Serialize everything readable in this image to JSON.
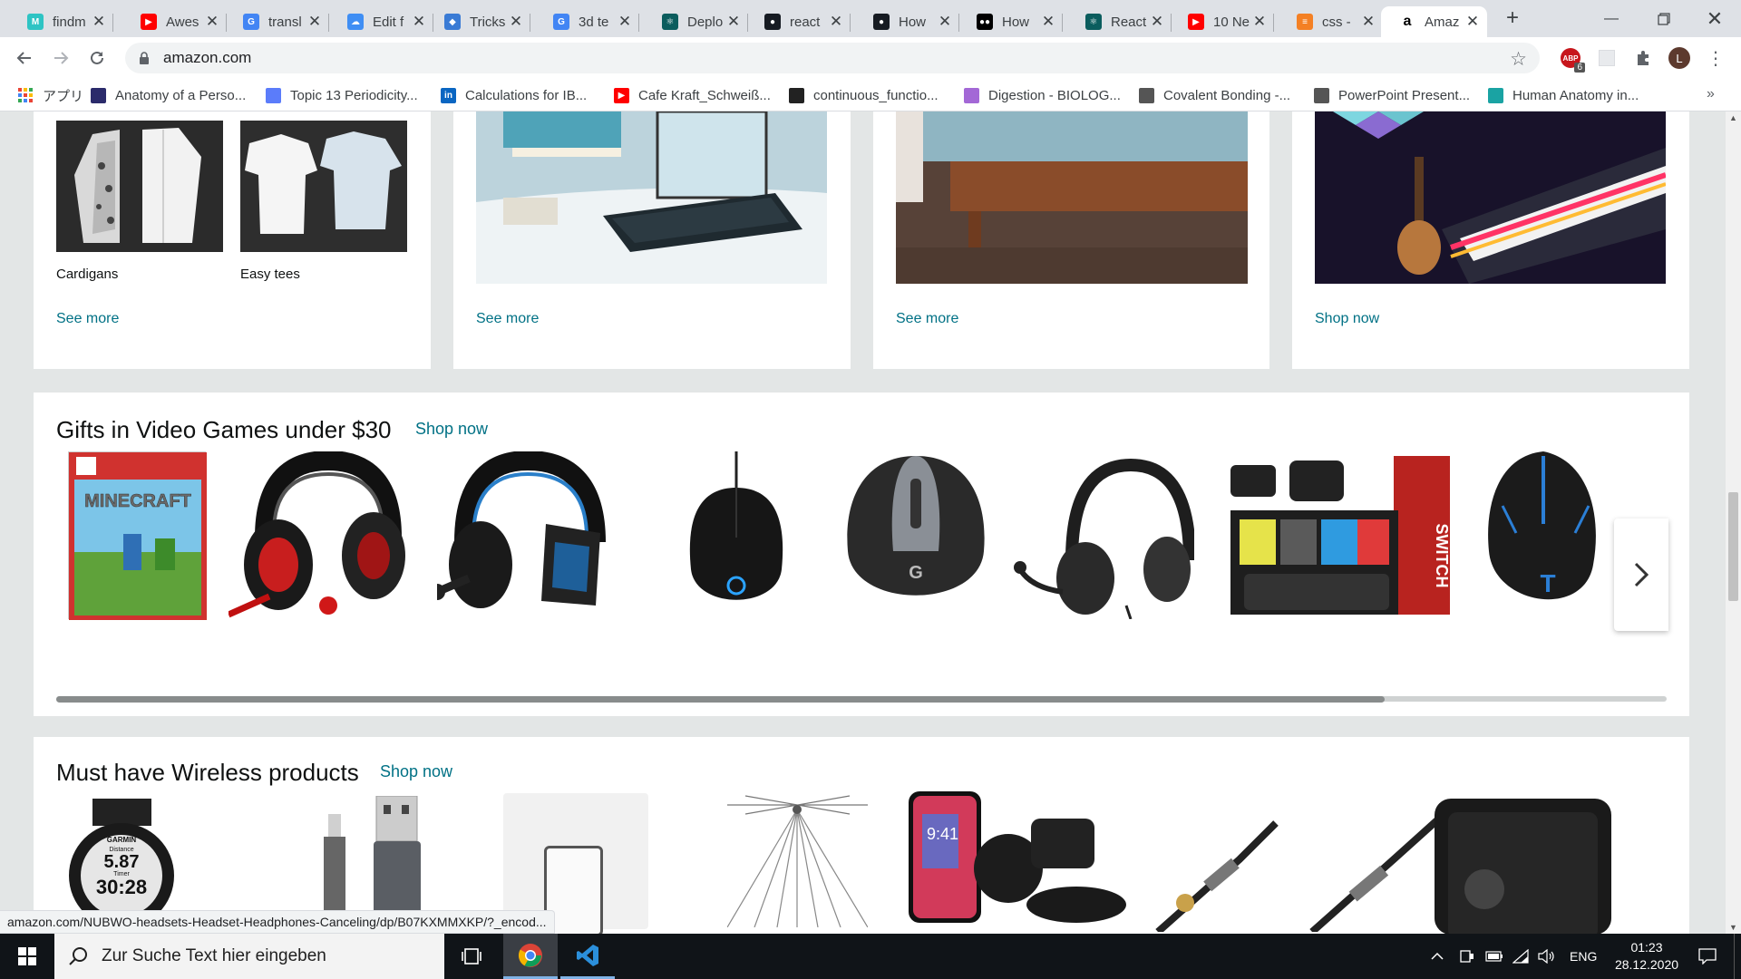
{
  "browser": {
    "tabs": [
      {
        "title": "findm",
        "favicon_color": "#2ec4c4",
        "favicon": "M"
      },
      {
        "title": "Awes",
        "favicon_color": "#ff0000",
        "favicon": "▶"
      },
      {
        "title": "transl",
        "favicon_color": "#4285f4",
        "favicon": "G"
      },
      {
        "title": "Edit f",
        "favicon_color": "#3f8ef4",
        "favicon": "☁"
      },
      {
        "title": "Tricks",
        "favicon_color": "#3a7bd5",
        "favicon": "◆"
      },
      {
        "title": "3d te",
        "favicon_color": "#4285f4",
        "favicon": "G"
      },
      {
        "title": "Deplo",
        "favicon_color": "#0b5d5e",
        "favicon": "⚛"
      },
      {
        "title": "react",
        "favicon_color": "#161b22",
        "favicon": "●"
      },
      {
        "title": "How",
        "favicon_color": "#161b22",
        "favicon": "●"
      },
      {
        "title": "How",
        "favicon_color": "#000000",
        "favicon": "●●"
      },
      {
        "title": "React",
        "favicon_color": "#0b5d5e",
        "favicon": "⚛"
      },
      {
        "title": "10 Ne",
        "favicon_color": "#ff0000",
        "favicon": "▶"
      },
      {
        "title": "css -",
        "favicon_color": "#f48024",
        "favicon": "≡"
      },
      {
        "title": "Amaz",
        "favicon_color": "#ffffff",
        "favicon": "a"
      }
    ],
    "url": "amazon.com",
    "profile_initial": "L",
    "abp_badge": "6",
    "bookmarks": [
      {
        "label": "アプリ",
        "icon": "apps-grid-icon",
        "color": "#ea4335"
      },
      {
        "label": "Anatomy of a Perso...",
        "icon": "bookmark-favicon-icon",
        "color": "#2b2b6b"
      },
      {
        "label": "Topic 13 Periodicity...",
        "icon": "bookmark-favicon-icon",
        "color": "#5b7cfa"
      },
      {
        "label": "Calculations for IB...",
        "icon": "linkedin-icon",
        "color": "#0a66c2"
      },
      {
        "label": "Cafe Kraft_Schweiß...",
        "icon": "youtube-icon",
        "color": "#ff0000"
      },
      {
        "label": "continuous_functio...",
        "icon": "bookmark-favicon-icon",
        "color": "#222222"
      },
      {
        "label": "Digestion - BIOLOG...",
        "icon": "bookmark-favicon-icon",
        "color": "#a368d6"
      },
      {
        "label": "Covalent Bonding -...",
        "icon": "bookmark-favicon-icon",
        "color": "#555555"
      },
      {
        "label": "PowerPoint Present...",
        "icon": "bookmark-favicon-icon",
        "color": "#555555"
      },
      {
        "label": "Human Anatomy in...",
        "icon": "bookmark-favicon-icon",
        "color": "#1aa3a3"
      }
    ],
    "status_url": "amazon.com/NUBWO-headsets-Headset-Headphones-Canceling/dp/B07KXMMXKP/?_encod..."
  },
  "page": {
    "top_cards": {
      "card1": {
        "item1": "Cardigans",
        "item2": "Easy tees",
        "link": "See more"
      },
      "card2": {
        "link": "See more"
      },
      "card3": {
        "link": "See more"
      },
      "card4": {
        "link": "Shop now"
      }
    },
    "shelf_games": {
      "title": "Gifts in Video Games under $30",
      "link": "Shop now",
      "products": [
        "switch-game-icon",
        "red-gaming-headset-icon",
        "blue-gaming-headset-icon",
        "gaming-mouse-icon",
        "large-gaming-mouse-icon",
        "headset-with-mic-icon",
        "switch-carry-case-icon",
        "rgb-gaming-mouse-icon"
      ]
    },
    "shelf_wireless": {
      "title": "Must have Wireless products",
      "link": "Shop now",
      "watch_distance": "5.87",
      "watch_time": "30:28",
      "watch_brand": "GARMIN",
      "watch_label_distance": "Distance",
      "watch_label_timer": "Timer",
      "phone_time": "9:41"
    }
  },
  "taskbar": {
    "search_placeholder": "Zur Suche Text hier eingeben",
    "language": "ENG",
    "time": "01:23",
    "date": "28.12.2020"
  }
}
